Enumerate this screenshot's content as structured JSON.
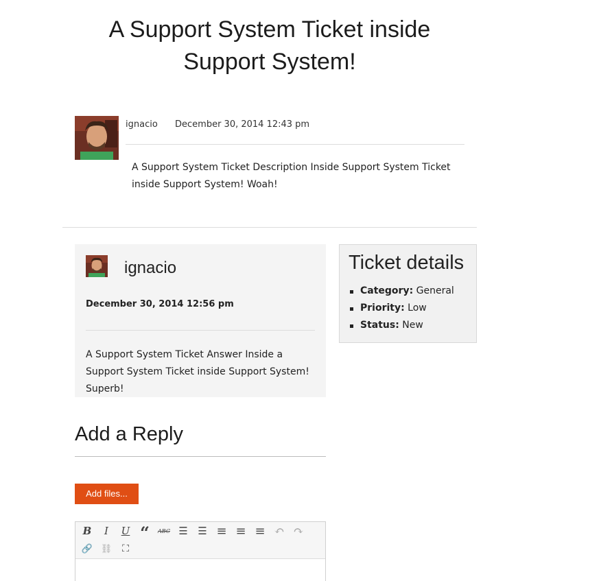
{
  "page": {
    "title": "A Support System Ticket inside Support System!"
  },
  "ticket": {
    "author": "ignacio",
    "date": "December 30, 2014 12:43 pm",
    "description": "A Support System Ticket Description Inside Support System Ticket inside Support System! Woah!"
  },
  "reply": {
    "author": "ignacio",
    "date": "December 30, 2014 12:56 pm",
    "body": "A Support System Ticket Answer Inside a Support System Ticket inside Support System! Superb!"
  },
  "details": {
    "title": "Ticket details",
    "items": [
      {
        "label": "Category:",
        "value": "General"
      },
      {
        "label": "Priority:",
        "value": "Low"
      },
      {
        "label": "Status:",
        "value": "New"
      }
    ]
  },
  "add_reply": {
    "heading": "Add a Reply",
    "add_files_label": "Add files..."
  },
  "editor": {
    "toolbar": [
      {
        "name": "bold",
        "glyph": "B"
      },
      {
        "name": "italic",
        "glyph": "I"
      },
      {
        "name": "underline",
        "glyph": "U"
      },
      {
        "name": "blockquote",
        "glyph": "“"
      },
      {
        "name": "strikethrough",
        "glyph": "ABC"
      },
      {
        "name": "bullet-list",
        "glyph": "☰"
      },
      {
        "name": "numbered-list",
        "glyph": "☰"
      },
      {
        "name": "align-left",
        "glyph": "≡"
      },
      {
        "name": "align-center",
        "glyph": "≡"
      },
      {
        "name": "align-right",
        "glyph": "≡"
      },
      {
        "name": "undo",
        "glyph": "↶"
      },
      {
        "name": "redo",
        "glyph": "↷"
      },
      {
        "name": "link",
        "glyph": "🔗"
      },
      {
        "name": "unlink",
        "glyph": "⛓"
      },
      {
        "name": "fullscreen",
        "glyph": "⛶"
      }
    ]
  },
  "colors": {
    "accent_button": "#e04e14",
    "panel_bg": "#f4f4f4",
    "details_bg": "#f1f1f1"
  }
}
